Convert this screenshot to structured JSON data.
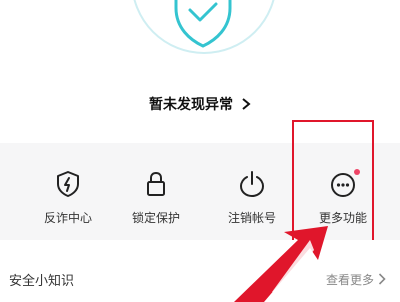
{
  "security": {
    "status_text": "暂未发现异常"
  },
  "actions": [
    {
      "label": "反诈中心",
      "icon": "fraud-shield-icon"
    },
    {
      "label": "锁定保护",
      "icon": "lock-icon"
    },
    {
      "label": "注销帐号",
      "icon": "power-icon"
    },
    {
      "label": "更多功能",
      "icon": "more-icon",
      "has_badge": true
    }
  ],
  "tips": {
    "title": "安全小知识",
    "see_more_label": "查看更多"
  },
  "colors": {
    "accent": "#34c4d0",
    "badge": "#ee4466",
    "annotation": "#e0162b"
  }
}
